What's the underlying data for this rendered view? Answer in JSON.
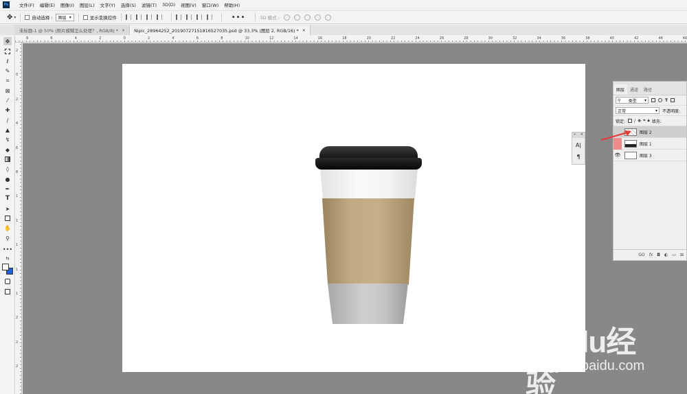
{
  "menubar": {
    "app_logo": "Ps",
    "items": [
      "文件(F)",
      "编辑(E)",
      "图像(I)",
      "图层(L)",
      "文字(Y)",
      "选择(S)",
      "滤镜(T)",
      "3D(D)",
      "视图(V)",
      "窗口(W)",
      "帮助(H)"
    ]
  },
  "options": {
    "auto_select_label": "自动选择 :",
    "auto_select_value": "图层",
    "show_transform_label": "显示变换控件",
    "more_label": "•••",
    "mode_3d_label": "3D 模式 :"
  },
  "tabs": [
    {
      "label": "未标题-1 @ 50% (照片模糊怎么处理？, RGB/8) *",
      "close": "×"
    },
    {
      "label": "Nipic_28964252_20190727151816527035.psd @ 33.3% (图层 2, RGB/16) *",
      "close": "×"
    }
  ],
  "ruler": {
    "h_labels": [
      "8",
      "6",
      "4",
      "2",
      "0",
      "2",
      "4",
      "6",
      "8",
      "10",
      "12",
      "14",
      "16",
      "18",
      "20",
      "22",
      "24",
      "26",
      "28",
      "30",
      "32",
      "34",
      "36",
      "38",
      "40",
      "42",
      "44",
      "46"
    ],
    "v_labels": [
      "2",
      "0",
      "2",
      "4",
      "6",
      "8",
      "1",
      "1",
      "1",
      "1",
      "1",
      "2",
      "2",
      "2"
    ]
  },
  "toolbar": {
    "tools": [
      "move-tool",
      "marquee-tool",
      "lasso-tool",
      "quick-select-tool",
      "crop-tool",
      "frame-tool",
      "eyedropper-tool",
      "healing-tool",
      "brush-tool",
      "stamp-tool",
      "history-brush-tool",
      "eraser-tool",
      "gradient-tool",
      "blur-tool",
      "dodge-tool",
      "pen-tool",
      "type-tool",
      "path-select-tool",
      "rectangle-tool",
      "hand-tool",
      "zoom-tool",
      "more-tools",
      "swap-colors",
      "quick-mask",
      "screen-mode"
    ],
    "type_glyph": "T"
  },
  "mini_panel": {
    "close": "×",
    "collapse": "»",
    "char_glyph": "A|",
    "para_glyph": "¶"
  },
  "layers_panel": {
    "tabs": [
      "图层",
      "通道",
      "路径"
    ],
    "filter_kind": "类型",
    "blend_mode": "正常",
    "opacity_label": "不透明度:",
    "lock_label": "锁定:",
    "fill_label": "填充:",
    "layers": [
      {
        "name": "图层 2",
        "selected": true,
        "visible": false
      },
      {
        "name": "图层 1",
        "selected": false,
        "visible": false
      },
      {
        "name": "图层 3",
        "selected": false,
        "visible": true
      }
    ],
    "bottom_icons": [
      "GO",
      "fx"
    ]
  },
  "colors": {
    "foreground": "#ffffff",
    "background": "#1f5fd6",
    "hidden_layer_eye": "#f08b8b",
    "arrow": "#e53935"
  },
  "watermark": {
    "logo": "Baidu经验",
    "url": "jingyan.baidu.com"
  }
}
